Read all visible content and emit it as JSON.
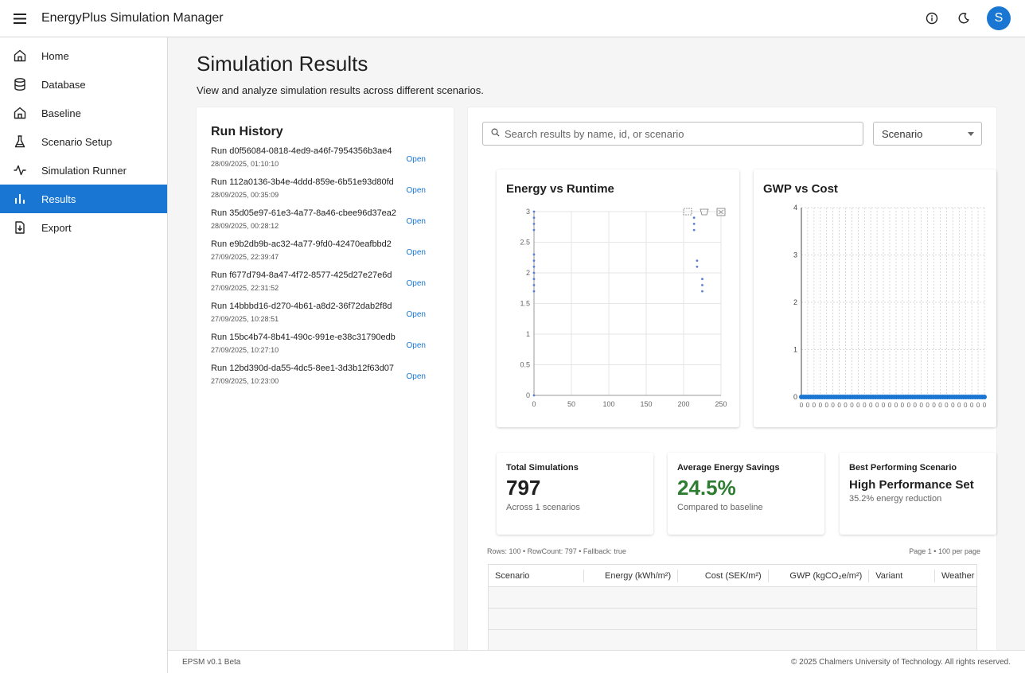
{
  "app": {
    "title": "EnergyPlus Simulation Manager",
    "avatar_initial": "S"
  },
  "nav": [
    {
      "label": "Home",
      "icon": "home-icon"
    },
    {
      "label": "Database",
      "icon": "database-icon"
    },
    {
      "label": "Baseline",
      "icon": "home-icon"
    },
    {
      "label": "Scenario Setup",
      "icon": "flask-icon"
    },
    {
      "label": "Simulation Runner",
      "icon": "activity-icon"
    },
    {
      "label": "Results",
      "icon": "bar-chart-icon",
      "active": true
    },
    {
      "label": "Export",
      "icon": "export-icon"
    }
  ],
  "page": {
    "title": "Simulation Results",
    "subtitle": "View and analyze simulation results across different scenarios."
  },
  "history": {
    "title": "Run History",
    "open_label": "Open",
    "runs": [
      {
        "name": "Run d0f56084-0818-4ed9-a46f-7954356b3ae4",
        "date": "28/09/2025, 01:10:10"
      },
      {
        "name": "Run 112a0136-3b4e-4ddd-859e-6b51e93d80fd",
        "date": "28/09/2025, 00:35:09"
      },
      {
        "name": "Run 35d05e97-61e3-4a77-8a46-cbee96d37ea2",
        "date": "28/09/2025, 00:28:12"
      },
      {
        "name": "Run e9b2db9b-ac32-4a77-9fd0-42470eafbbd2",
        "date": "27/09/2025, 22:39:47"
      },
      {
        "name": "Run f677d794-8a47-4f72-8577-425d27e27e6d",
        "date": "27/09/2025, 22:31:52"
      },
      {
        "name": "Run 14bbbd16-d270-4b61-a8d2-36f72dab2f8d",
        "date": "27/09/2025, 10:28:51"
      },
      {
        "name": "Run 15bc4b74-8b41-490c-991e-e38c31790edb",
        "date": "27/09/2025, 10:27:10"
      },
      {
        "name": "Run 12bd390d-da55-4dc5-8ee1-3d3b12f63d07",
        "date": "27/09/2025, 10:23:00"
      }
    ]
  },
  "search": {
    "placeholder": "Search results by name, id, or scenario"
  },
  "filter": {
    "selected": "Scenario"
  },
  "chart_data": [
    {
      "type": "scatter",
      "title": "Energy vs Runtime",
      "xlabel": "",
      "ylabel": "",
      "xlim": [
        0,
        250
      ],
      "ylim": [
        0,
        3
      ],
      "xticks": [
        0,
        50,
        100,
        150,
        200,
        250
      ],
      "yticks": [
        0,
        0.5,
        1,
        1.5,
        2,
        2.5,
        3
      ],
      "grid": true,
      "color": "#5b7fd6",
      "points": [
        [
          0,
          3.0
        ],
        [
          0,
          2.9
        ],
        [
          0,
          2.8
        ],
        [
          0,
          2.7
        ],
        [
          0,
          2.3
        ],
        [
          0,
          2.2
        ],
        [
          0,
          2.1
        ],
        [
          0,
          2.0
        ],
        [
          0,
          1.9
        ],
        [
          0,
          1.8
        ],
        [
          0,
          1.7
        ],
        [
          0,
          0
        ],
        [
          214,
          2.9
        ],
        [
          214,
          2.8
        ],
        [
          214,
          2.7
        ],
        [
          218,
          2.2
        ],
        [
          218,
          2.1
        ],
        [
          225,
          1.9
        ],
        [
          225,
          1.8
        ],
        [
          225,
          1.7
        ]
      ]
    },
    {
      "type": "scatter",
      "title": "GWP vs Cost",
      "xlabel": "",
      "ylabel": "",
      "ylim": [
        0,
        4
      ],
      "yticks": [
        0,
        1,
        2,
        3,
        4
      ],
      "xtick_labels": [
        "0",
        "0",
        "0",
        "0",
        "0",
        "0",
        "0",
        "0",
        "0",
        "0",
        "0",
        "0",
        "0",
        "0",
        "0",
        "0",
        "0",
        "0",
        "0",
        "0",
        "0",
        "0",
        "0",
        "0",
        "0",
        "0",
        "0",
        "0",
        "0",
        "0"
      ],
      "grid": true,
      "color": "#1976d2",
      "y_value": 0
    }
  ],
  "stats": [
    {
      "label": "Total Simulations",
      "value": "797",
      "note": "Across 1 scenarios"
    },
    {
      "label": "Average Energy Savings",
      "value": "24.5%",
      "note": "Compared to baseline"
    },
    {
      "label": "Best Performing Scenario",
      "value": "High Performance Set",
      "note": "35.2% energy reduction"
    }
  ],
  "grid": {
    "meta_left": "Rows: 100 • RowCount: 797 • Fallback: true",
    "meta_right": "Page 1 • 100 per page",
    "columns": [
      "Scenario",
      "Energy (kWh/m²)",
      "Cost (SEK/m²)",
      "GWP (kgCO₂e/m²)",
      "Variant",
      "Weather"
    ]
  },
  "footer": {
    "left": "EPSM v0.1 Beta",
    "right": "© 2025 Chalmers University of Technology. All rights reserved."
  }
}
